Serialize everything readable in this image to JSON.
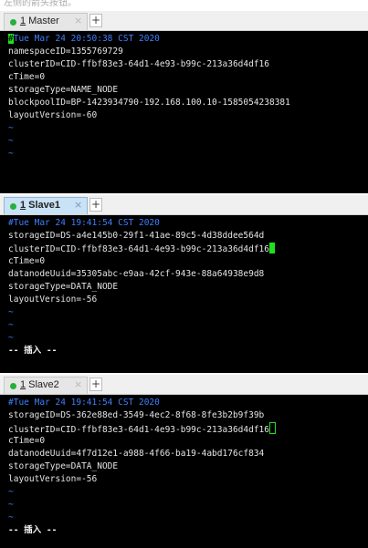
{
  "top_fragment": "左侧的箭头按钮。",
  "panes": [
    {
      "tab": {
        "number": "1",
        "label": "Master",
        "close": "×",
        "add": "+"
      },
      "lines": [
        "Tue Mar 24 20:50:38 CST 2020",
        "namespaceID=1355769729",
        "clusterID=CID-ffbf83e3-64d1-4e93-b99c-213a36d4df16",
        "cTime=0",
        "storageType=NAME_NODE",
        "blockpoolID=BP-1423934790-192.168.100.10-1585054238381",
        "layoutVersion=-60",
        "~",
        "~",
        "~"
      ],
      "cursor_char": "#"
    },
    {
      "tab": {
        "number": "1",
        "label": "Slave1",
        "close": "×",
        "add": "+"
      },
      "lines": [
        "#Tue Mar 24 19:41:54 CST 2020",
        "storageID=DS-a4e145b0-29f1-41ae-89c5-4d38ddee564d",
        "clusterID=CID-ffbf83e3-64d1-4e93-b99c-213a36d4df16",
        "cTime=0",
        "datanodeUuid=35305abc-e9aa-42cf-943e-88a64938e9d8",
        "storageType=DATA_NODE",
        "layoutVersion=-56",
        "~",
        "~",
        "~"
      ],
      "mode": "-- 插入 --"
    },
    {
      "tab": {
        "number": "1",
        "label": "Slave2",
        "close": "×",
        "add": "+"
      },
      "lines": [
        "#Tue Mar 24 19:41:54 CST 2020",
        "storageID=DS-362e88ed-3549-4ec2-8f68-8fe3b2b9f39b",
        "clusterID=CID-ffbf83e3-64d1-4e93-b99c-213a36d4df16",
        "cTime=0",
        "datanodeUuid=4f7d12e1-a988-4f66-ba19-4abd176cf834",
        "storageType=DATA_NODE",
        "layoutVersion=-56",
        "~",
        "~",
        "~"
      ],
      "mode": "-- 插入 --"
    }
  ],
  "colors": {
    "terminal_bg": "#000000",
    "text": "#e4e4e4",
    "comment": "#3d7fff",
    "cursor": "#1fe01f",
    "status_dot": "#25b03a",
    "active_tab": "#c9e2f6"
  }
}
